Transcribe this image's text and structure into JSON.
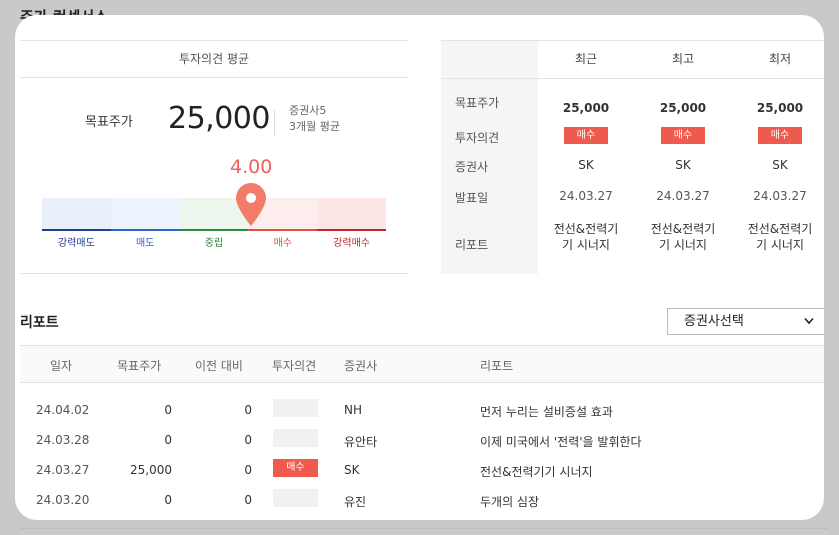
{
  "page_title": "주가 컨센서스",
  "avg_header": "투자의견 평균",
  "target": {
    "label": "목표주가",
    "value": "25,000",
    "meta_line1": "증권사5",
    "meta_line2": "3개월 평균"
  },
  "opinion_score": "4.00",
  "gauge": {
    "labels": [
      "강력매도",
      "매도",
      "중립",
      "매수",
      "강력매수"
    ],
    "label_colors": [
      "#1f3f8f",
      "#2f63c8",
      "#2e8b3a",
      "#e0503c",
      "#c0262b"
    ],
    "segment_fills": [
      "#eaf0fb",
      "#eef4fd",
      "#ebf7ec",
      "#fdeeed",
      "#fde6e6"
    ],
    "segment_lines": [
      "#1f3f8f",
      "#2f63c8",
      "#2e8b3a",
      "#e0503c",
      "#c0262b"
    ],
    "pin_color": "#f27b6a"
  },
  "summary": {
    "columns": [
      "최근",
      "최고",
      "최저"
    ],
    "row_labels": [
      "목표주가",
      "투자의견",
      "증권사",
      "발표일",
      "리포트"
    ],
    "cols": [
      {
        "target": "25,000",
        "opinion": "매수",
        "broker": "SK",
        "date": "24.03.27",
        "report1": "전선&전력기",
        "report2": "기 시너지"
      },
      {
        "target": "25,000",
        "opinion": "매수",
        "broker": "SK",
        "date": "24.03.27",
        "report1": "전선&전력기",
        "report2": "기 시너지"
      },
      {
        "target": "25,000",
        "opinion": "매수",
        "broker": "SK",
        "date": "24.03.27",
        "report1": "전선&전력기",
        "report2": "기 시너지"
      }
    ]
  },
  "reports": {
    "title": "리포트",
    "dropdown_label": "증권사선택",
    "headers": [
      "일자",
      "목표주가",
      "이전 대비",
      "투자의견",
      "증권사",
      "리포트"
    ],
    "rows": [
      {
        "date": "24.04.02",
        "target": "0",
        "change": "0",
        "opinion": "",
        "broker": "NH",
        "report": "먼저 누리는 설비증설 효과"
      },
      {
        "date": "24.03.28",
        "target": "0",
        "change": "0",
        "opinion": "",
        "broker": "유안타",
        "report": "이제 미국에서 '전력'을 발휘한다"
      },
      {
        "date": "24.03.27",
        "target": "25,000",
        "change": "0",
        "opinion": "매수",
        "broker": "SK",
        "report": "전선&전력기기 시너지"
      },
      {
        "date": "24.03.20",
        "target": "0",
        "change": "0",
        "opinion": "",
        "broker": "유진",
        "report": "두개의 심장"
      }
    ]
  }
}
